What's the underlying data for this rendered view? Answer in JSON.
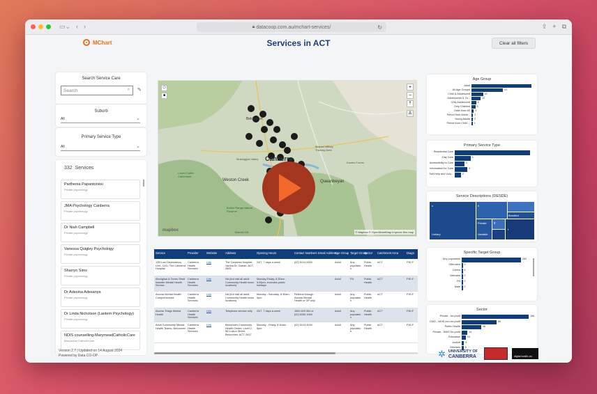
{
  "browser": {
    "url": "datacoop.com.au/mchart-services/"
  },
  "header": {
    "brand": "MChart",
    "title": "Services in ACT",
    "clear_label": "Clear all filters"
  },
  "filters": {
    "search_title": "Search Service Care",
    "search_placeholder": "Search",
    "suburb_title": "Suburb",
    "suburb_value": "All",
    "type_title": "Primary Service Type",
    "type_value": "All"
  },
  "services": {
    "count": "332",
    "label": "Services",
    "items": [
      {
        "name": "Parthenia Papantoniou",
        "type": "Private psychology"
      },
      {
        "name": "JMA Psychology Canberra",
        "type": "Private psychology"
      },
      {
        "name": "Dr Niah Campbell",
        "type": "Private psychology"
      },
      {
        "name": "Vanessa Quigley Psychology",
        "type": "Private psychology"
      },
      {
        "name": "Sharryn Sims",
        "type": "Private psychology"
      },
      {
        "name": "Dr Adesina Adesanya",
        "type": "Private psychology"
      },
      {
        "name": "Dr Linda Nicholson (Lantern Psychology)",
        "type": "Private psychology"
      },
      {
        "name": "NDIS counselling-MarymeadCatholicCare",
        "type": "Marymead CatholicCare"
      }
    ]
  },
  "map": {
    "city": "Canberra",
    "labels": [
      "Belconnen",
      "Weston Creek",
      "Queanbeyan",
      "Majura Military Training Area",
      "Kowen Forest",
      "Lower Cotter Catchment",
      "Bullen Range Nature Reserve",
      "Mulanggari Valley"
    ],
    "attribution": "© Mapbox © OpenStreetMap Improve this map",
    "mapbox": "mapbox",
    "suburb_bottom": "Barnes Hill"
  },
  "table": {
    "columns": [
      "Service",
      "Provider",
      "Website",
      "Address",
      "Opening Hours",
      "Contact Numbers",
      "Email Address",
      "Age Group",
      "Target Group",
      "Sector",
      "Catchment Area",
      "Diagn"
    ],
    "rows": [
      [
        "12B Low Dependency Unit - LDU, The Canberra Hospital",
        "Canberra Health Services",
        "Link",
        "The Canberra Hospital, Yamba Dr, Garran, ACT, 2605",
        "24/7, 7 days a week",
        "(02) 5124 0000",
        "",
        "Adult",
        "Any populatio n",
        "Public Health",
        "ACT",
        "F90-F"
      ],
      [
        "Aboriginal & Torres Strait Islander Mental Health Service",
        "Canberra Health Services",
        "Link",
        "NA (but visit all adult Community Health team locations)",
        "Monday-Friday, 8.30am - 5:30pm, excludes public holidays",
        "",
        "",
        "Adult",
        "FN",
        "Public Health",
        "ACT",
        "F90-F"
      ],
      [
        "Access Mental Health Comprehensive",
        "Canberra Health Services",
        "Link",
        "NA (but visit all adult Community Health team locations)",
        "Monday - Saturday, 8.30am-5pm",
        "Referral through Access Mental Health or GP only",
        "",
        "Adult",
        "Any populatio n",
        "Public Health",
        "ACT",
        "F90-F"
      ],
      [
        "Access Triage Mental Health",
        "Canberra Health Services",
        "Link",
        "Telephone service only",
        "24/7, 7 days a week",
        "1800 629 354 or (02) 6205 1065",
        "",
        "Adult",
        "Any populatio n",
        "Public Health",
        "ACT",
        "F90-F"
      ],
      [
        "Adult Community Mental Health Teams- Belconnen",
        "Canberra Health Services",
        "Link",
        "Belconnen Community Health Centre, Level 2, 56 Luxton Street, Belconnen, ACT, 2617",
        "Monday - Friday, 8.30am - 5pm",
        "(02) 5124 4294",
        "",
        "Adult",
        "Any populatio n",
        "Public Health",
        "ACT",
        "F90-F"
      ]
    ]
  },
  "age_chart": {
    "title": "Age Group",
    "categories": [
      "Adult",
      "All Age Groups",
      "Child & Adolescent",
      "Adolescents & Yo...",
      "Only Adolescent",
      "Only Children",
      "Older than 60",
      "Period from Adole...",
      "Young Adults",
      "Period from Child ..."
    ],
    "values": [
      null,
      41,
      15,
      12,
      6,
      5,
      3,
      2,
      2,
      1
    ]
  },
  "type_chart": {
    "title": "Primary Service Type",
    "categories": [
      "Residential Care",
      "Day Care",
      "Accessibility to Care",
      "Information for Care",
      "Self-Help and Volu..."
    ],
    "values": [
      null,
      5,
      3,
      4,
      2
    ]
  },
  "desde": {
    "title": "Service Descriptions (DESDE)",
    "cells": [
      "u",
      "h",
      "Bundled",
      "Private",
      "g",
      "Unitary",
      "Variable",
      "t"
    ]
  },
  "target_chart": {
    "title": "Specific Target Group",
    "categories": [
      "Any population",
      "Offenders",
      "Carers",
      "Veterans",
      "FN",
      "Male"
    ],
    "values": [
      283,
      3,
      4,
      2,
      2,
      2
    ]
  },
  "sector_chart": {
    "title": "Sector",
    "categories": [
      "Private - for-profit",
      "CMO - NDIS non-for-profit",
      "Public Health",
      "Private - NDIS for-profit",
      "Education",
      "Justice",
      "Veterans"
    ],
    "values": [
      166,
      86,
      48,
      14,
      10,
      6,
      5
    ]
  },
  "footer": {
    "version": "Version 2.7 | Updated on 14 August 2024",
    "powered": "Powered by Data CO-OP",
    "uni1": "UNIVERSITY OF",
    "uni2": "CANBERRA",
    "partner": "digital health crc"
  },
  "colors": {
    "navy": "#0f3e7a",
    "title": "#1f3a7a",
    "brand": "#e8701a",
    "play": "#a4351f"
  }
}
